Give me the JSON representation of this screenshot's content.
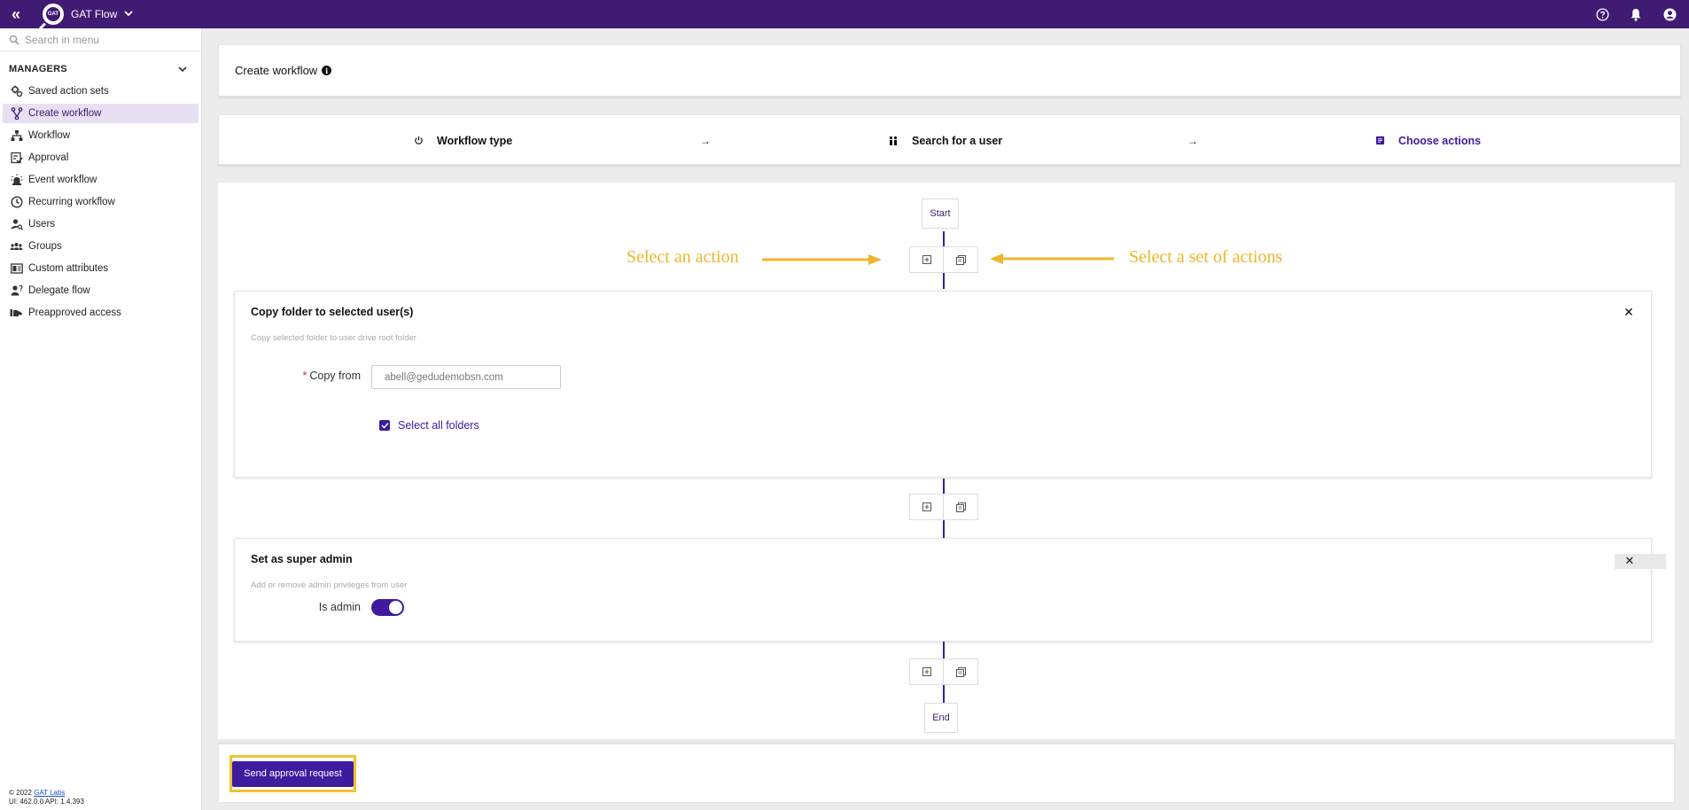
{
  "topbar": {
    "app_name": "GAT Flow",
    "logo_text": "GAT",
    "icons": [
      "collapse-sidebar-icon",
      "help-icon",
      "notifications-bell-icon",
      "account-icon"
    ]
  },
  "sidebar": {
    "search_placeholder": "Search in menu",
    "section_title": "MANAGERS",
    "items": [
      {
        "label": "Saved action sets",
        "icon": "gears-icon",
        "active": false
      },
      {
        "label": "Create workflow",
        "icon": "branch-icon",
        "active": true
      },
      {
        "label": "Workflow",
        "icon": "hierarchy-icon",
        "active": false
      },
      {
        "label": "Approval",
        "icon": "checklist-icon",
        "active": false
      },
      {
        "label": "Event workflow",
        "icon": "siren-icon",
        "active": false
      },
      {
        "label": "Recurring workflow",
        "icon": "clock-icon",
        "active": false
      },
      {
        "label": "Users",
        "icon": "user-search-icon",
        "active": false
      },
      {
        "label": "Groups",
        "icon": "group-icon",
        "active": false
      },
      {
        "label": "Custom attributes",
        "icon": "attributes-card-icon",
        "active": false
      },
      {
        "label": "Delegate flow",
        "icon": "user-question-icon",
        "active": false
      },
      {
        "label": "Preapproved access",
        "icon": "preapproved-icon",
        "active": false
      }
    ],
    "footer": {
      "copyright": "© 2022 ",
      "company_link": "GAT Labs",
      "version": "UI: 462.0.0 API: 1.4.393"
    }
  },
  "header": {
    "title": "Create workflow",
    "info_glyph": "i"
  },
  "steps": [
    {
      "label": "Workflow type",
      "icon": "power-icon",
      "active": false
    },
    {
      "label": "Search for a user",
      "icon": "users-icon",
      "active": false
    },
    {
      "label": "Choose actions",
      "icon": "actions-doc-icon",
      "active": true
    }
  ],
  "step_arrow": "→",
  "flow": {
    "start_label": "Start",
    "end_label": "End",
    "annotations": {
      "left": "Select an action",
      "right": "Select a set of actions"
    },
    "actions": [
      {
        "title": "Copy folder to selected user(s)",
        "description": "Copy selected folder to user drive root folder",
        "fields": {
          "copy_from_label": "Copy from",
          "copy_from_value": "abell@gedudemobsn.com",
          "required": true,
          "select_all_label": "Select all folders",
          "select_all_checked": true
        }
      },
      {
        "title": "Set as super admin",
        "description": "Add or remove admin privileges from user",
        "fields": {
          "is_admin_label": "Is admin",
          "is_admin_on": true
        },
        "ghost_tooltip": "Delete"
      }
    ]
  },
  "footer_actions": {
    "send_label": "Send approval request"
  },
  "colors": {
    "brand": "#3f1b73",
    "accent": "#3f1b9f",
    "annotation": "#f0b52c",
    "highlight_border": "#f0c231"
  }
}
